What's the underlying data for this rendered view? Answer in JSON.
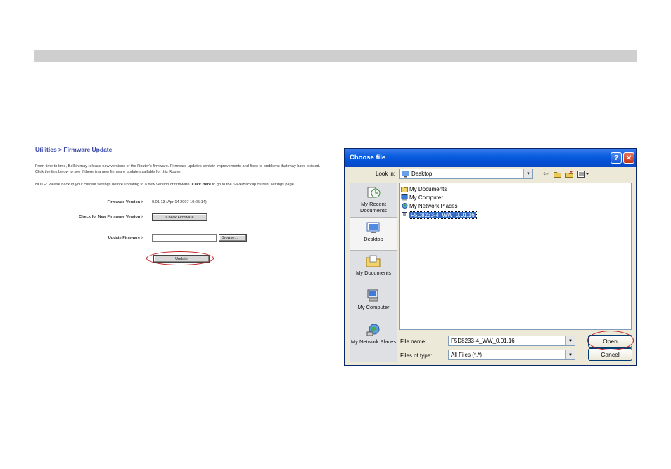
{
  "router_page": {
    "title": "Utilities > Firmware Update",
    "paragraph1": "From time to time, Belkin may release new versions of the Router's firmware. Firmware updates contain improvements and fixes to problems that may have existed. Click the link below to see if there is a new firmware update available for this Router.",
    "note_prefix": "NOTE: Please backup your current settings before updating to a new version of firmware.",
    "note_link": "Click Here",
    "note_suffix": "to go to the Save/Backup current settings page.",
    "firmware_version_label": "Firmware Version >",
    "firmware_version_value": "0.01.13 (Apr 14 2007 19:25:14)",
    "check_label": "Check for New Firmware Version >",
    "check_button": "Check Firmware",
    "update_label": "Update Firmware >",
    "browse_button": "Browse...",
    "update_button": "Update"
  },
  "dialog": {
    "title": "Choose file",
    "help_button": "?",
    "close_button": "✕",
    "look_in_label": "Look in:",
    "look_in_value": "Desktop",
    "places": [
      {
        "label": "My Recent Documents",
        "icon": "recent-documents-icon"
      },
      {
        "label": "Desktop",
        "icon": "desktop-icon"
      },
      {
        "label": "My Documents",
        "icon": "my-documents-icon"
      },
      {
        "label": "My Computer",
        "icon": "my-computer-icon"
      },
      {
        "label": "My Network Places",
        "icon": "network-places-icon"
      }
    ],
    "files": [
      {
        "name": "My Documents",
        "icon": "folder-icon"
      },
      {
        "name": "My Computer",
        "icon": "computer-icon"
      },
      {
        "name": "My Network Places",
        "icon": "network-icon"
      },
      {
        "name": "F5D8233-4_WW_0.01.16",
        "icon": "file-icon",
        "selected": true
      }
    ],
    "file_name_label": "File name:",
    "file_name_value": "F5D8233-4_WW_0.01.16",
    "files_of_type_label": "Files of type:",
    "files_of_type_value": "All Files (*.*)",
    "open_button": "Open",
    "cancel_button": "Cancel"
  }
}
